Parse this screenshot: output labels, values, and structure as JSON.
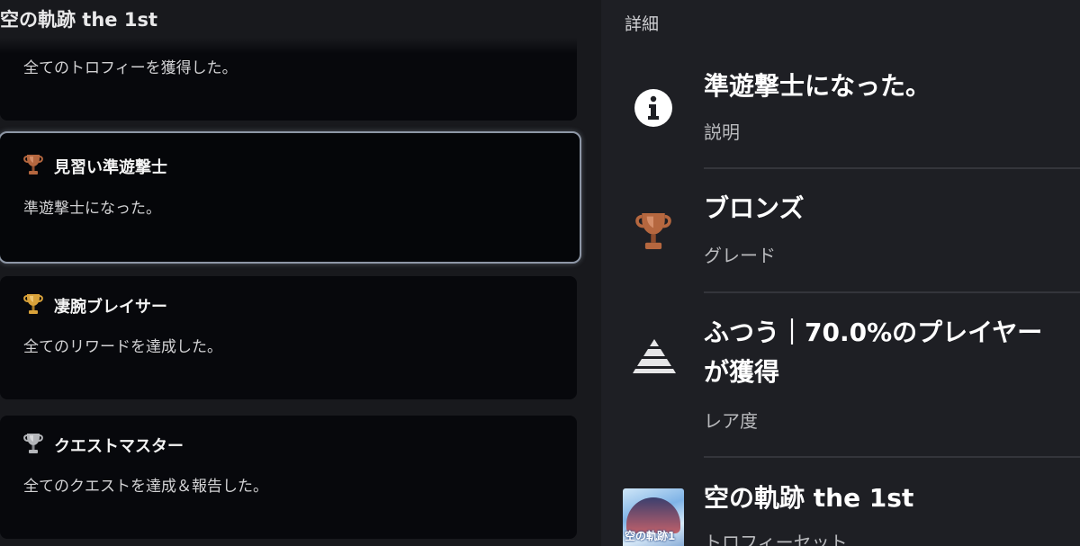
{
  "left_panel": {
    "game_title": "空の軌跡 the 1st",
    "trophies": [
      {
        "name": "",
        "description": "全てのトロフィーを獲得した。",
        "grade": "platinum"
      },
      {
        "name": "見習い準遊撃士",
        "description": "準遊撃士になった。",
        "grade": "bronze",
        "selected": true
      },
      {
        "name": "凄腕ブレイサー",
        "description": "全てのリワードを達成した。",
        "grade": "gold"
      },
      {
        "name": "クエストマスター",
        "description": "全てのクエストを達成＆報告した。",
        "grade": "silver"
      }
    ]
  },
  "details_panel": {
    "title": "詳細",
    "description": {
      "value": "準遊撃士になった。",
      "label": "説明",
      "icon": "info-icon"
    },
    "grade": {
      "value": "ブロンズ",
      "label": "グレード",
      "icon": "bronze-trophy-icon"
    },
    "rarity": {
      "value": "ふつう｜70.0%のプレイヤーが獲得",
      "label": "レア度",
      "icon": "rarity-pyramid-icon",
      "percent": 70.0
    },
    "trophy_set": {
      "value": "空の軌跡 the 1st",
      "label": "トロフィーセット",
      "boxart_text": "空の軌跡1"
    }
  },
  "colors": {
    "bronze": "#b5673f",
    "silver": "#b4b6ba",
    "gold": "#d9a23a",
    "selected_border": "#8e97a6",
    "card_bg": "#07080c",
    "panel_bg": "#1e1f24"
  }
}
